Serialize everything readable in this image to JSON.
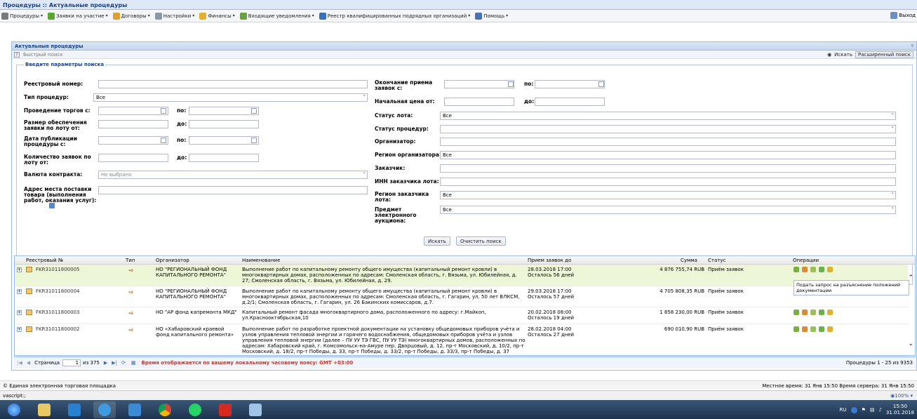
{
  "window": {
    "title": "Процедуры :: Актуальные процедуры"
  },
  "menu": {
    "items": [
      {
        "label": "Процедуры",
        "color": "#7a7a7a"
      },
      {
        "label": "Заявки на участие",
        "color": "#58a632"
      },
      {
        "label": "Договоры",
        "color": "#e0a030"
      },
      {
        "label": "Настройки",
        "color": "#8899aa"
      },
      {
        "label": "Финансы",
        "color": "#e0b030"
      },
      {
        "label": "Входящие уведомления",
        "color": "#6aa040"
      },
      {
        "label": "Реестр квалифицированных подрядных организаций",
        "color": "#3b6fb5"
      },
      {
        "label": "Помощь",
        "color": "#4a72b0"
      }
    ],
    "exit": "Выход"
  },
  "panel": {
    "title": "Актуальные процедуры",
    "quick_search": "Быстрый поиск",
    "search_btn": "Искать",
    "advanced_btn": "Расширенный поиск"
  },
  "form": {
    "legend": "Введите параметры поиска",
    "left": {
      "reg_no": "Реестровый номер:",
      "proc_type": "Тип процедур:",
      "proc_type_val": "Все",
      "auction_from": "Проведение торгов с:",
      "po": "по:",
      "deposit": "Размер обеспечения заявки по лоту от:",
      "do": "до:",
      "pub_date": "Дата публикации процедуры с:",
      "bids_count": "Количество заявок по лоту от:",
      "currency": "Валюта контракта:",
      "currency_val": "Не выбрано",
      "address": "Адрес места поставки товара (выполнения работ, оказания услуг):"
    },
    "right": {
      "end_bids": "Окончание приема заявок с:",
      "price_from": "Начальная цена от:",
      "lot_status": "Статус лота:",
      "lot_status_val": "Все",
      "proc_status": "Статус процедур:",
      "organizer": "Организатор:",
      "org_region": "Регион организатора:",
      "org_region_val": "Все",
      "customer": "Заказчик:",
      "inn": "ИНН заказчика лота:",
      "cust_region": "Регион заказчика лота:",
      "cust_region_val": "Все",
      "subject": "Предмет электронного аукциона:",
      "subject_val": "Все"
    },
    "search_btn": "Искать",
    "clear_btn": "Очистить поиск"
  },
  "grid": {
    "headers": {
      "reg": "Реестровый №",
      "type": "Тип",
      "org": "Организатор",
      "name": "Наименование",
      "deadline": "Прием заявок до",
      "sum": "Сумма",
      "status": "Статус",
      "ops": "Операции"
    },
    "rows": [
      {
        "reg": "FKR31011800005",
        "org": "НО \"РЕГИОНАЛЬНЫЙ ФОНД КАПИТАЛЬНОГО РЕМОНТА\"",
        "name": "Выполнение работ по капитальному ремонту общего имущества (капитальный ремонт кровли) в многоквартирных домах, расположенных по адресам: Смоленская область, г. Вязьма, ул. Юбилейная, д. 27; Смоленская область, г. Вязьма, ул. Юбилейная, д. 29.",
        "deadline": "28.03.2018 17:00",
        "left": "Осталось 56 дней",
        "sum": "4 876 755,74 RUB",
        "status": "Приём заявок"
      },
      {
        "reg": "FKR31011800004",
        "org": "НО \"РЕГИОНАЛЬНЫЙ ФОНД КАПИТАЛЬНОГО РЕМОНТА\"",
        "name": "Выполнение работ по капитальному ремонту общего имущества (капитальный ремонт кровли) в многоквартирных домах, расположенных по адресам: Смоленская область, г. Гагарин, ул. 50 лет ВЛКСМ, д.2/1; Смоленская область, г. Гагарин, ул. 26 Бакинских комиссаров, д.7.",
        "deadline": "29.03.2018 17:00",
        "left": "Осталось 57 дней",
        "sum": "4 705 808,35 RUB",
        "status": "Приём заявок"
      },
      {
        "reg": "FKR31011800003",
        "org": "НО \"АР фонд капремонта МКД\"",
        "name": "Капитальный ремонт фасада многоквартирного дома, расположенного по адресу: г.Майкоп, ул.Краснооктябрьская,10",
        "deadline": "20.02.2018 08:00",
        "left": "Осталось 19 дней",
        "sum": "1 858 230,00 RUB",
        "status": "Приём заявок"
      },
      {
        "reg": "FKR31011800002",
        "org": "НО «Хабаровский краевой фонд капитального ремонта»",
        "name": "Выполнение работ по разработке проектной документации на установку общедомовых приборов учёта и узлов управления тепловой энергии и горячего водоснабжения, общедомовых приборов учёта и узлов управления тепловой энергии (далее – ПУ УУ ТЭ ГВС, ПУ УУ ТЭ) многоквартирных домов, расположенных по адресам: Хабаровский край, г. Комсомольск-на-Амуре пер. Дворцовый, д. 12, пр-т Московский, д. 10/2, пр-т Московский, д. 18/2, пр-т Победы, д. 33, пр-т Победы, д. 33/2, пр-т Победы, д. 33/3, пр-т Победы, д. 37",
        "deadline": "28.02.2018 04:00",
        "left": "Осталось 27 дней",
        "sum": "690 010,90 RUB",
        "status": "Приём заявок"
      }
    ],
    "tooltip": "Подать запрос на разъяснение положений документации"
  },
  "pager": {
    "page_label": "Страница",
    "page": "1",
    "of": "из 375",
    "tz_note": "Время отображается по вашему локальному часовому поясу: GMT +03:00",
    "summary": "Процедуры 1 - 25 из 9353"
  },
  "footer": {
    "left": "© Единая электронная торговая площадка",
    "right": "Местное время: 31 Янв 15:50 Время сервера: 31 Янв 15:50"
  },
  "statusbar": {
    "left": "vascript:;",
    "zoom": "100%"
  },
  "taskbar": {
    "lang": "RU",
    "time": "15:50",
    "date": "31.01.2018"
  }
}
